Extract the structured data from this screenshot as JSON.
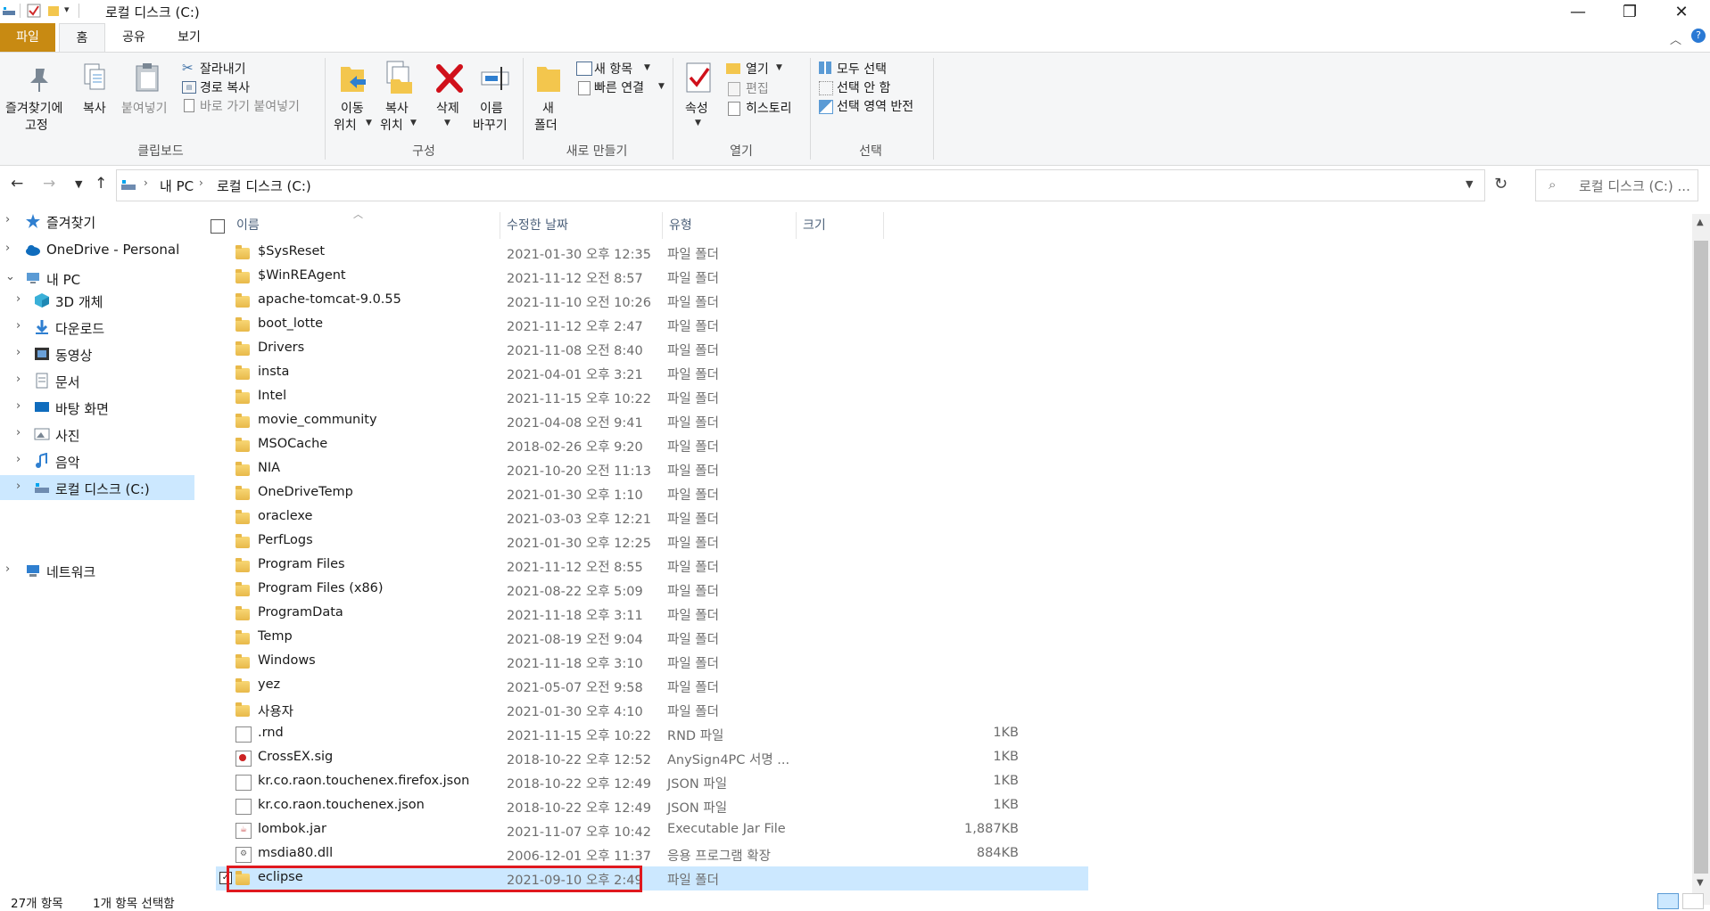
{
  "window": {
    "title": "로컬 디스크 (C:)",
    "qat_dropdown": "▾",
    "controls": {
      "minimize": "—",
      "restore": "❐",
      "close": "✕"
    }
  },
  "tabs": [
    "파일",
    "홈",
    "공유",
    "보기"
  ],
  "ribbon": {
    "clipboard": {
      "pin": "즐겨찾기에",
      "pin2": "고정",
      "copy": "복사",
      "paste": "붙여넣기",
      "cut": "잘라내기",
      "copy_path": "경로 복사",
      "paste_shortcut": "바로 가기 붙여넣기",
      "group": "클립보드"
    },
    "organize": {
      "move1": "이동",
      "move2": "위치",
      "copyto1": "복사",
      "copyto2": "위치",
      "delete": "삭제",
      "rename1": "이름",
      "rename2": "바꾸기",
      "group": "구성"
    },
    "new": {
      "folder1": "새",
      "folder2": "폴더",
      "new_item": "새 항목",
      "easy_access": "빠른 연결",
      "group": "새로 만들기"
    },
    "open": {
      "properties": "속성",
      "open": "열기",
      "edit": "편집",
      "history": "히스토리",
      "group": "열기"
    },
    "select": {
      "all": "모두 선택",
      "none": "선택 안 함",
      "invert": "선택 영역 반전",
      "group": "선택"
    }
  },
  "address": {
    "crumbs": [
      "내 PC",
      "로컬 디스크 (C:)"
    ],
    "search_placeholder": "로컬 디스크 (C:) ..."
  },
  "nav": {
    "favorites": "즐겨찾기",
    "onedrive": "OneDrive - Personal",
    "thispc": "내 PC",
    "children": [
      "3D 개체",
      "다운로드",
      "동영상",
      "문서",
      "바탕 화면",
      "사진",
      "음악",
      "로컬 디스크 (C:)"
    ],
    "network": "네트워크"
  },
  "columns": {
    "name": "이름",
    "date": "수정한 날짜",
    "type": "유형",
    "size": "크기"
  },
  "files": [
    {
      "name": "$SysReset",
      "date": "2021-01-30 오후 12:35",
      "type": "파일 폴더",
      "size": "",
      "kind": "folder"
    },
    {
      "name": "$WinREAgent",
      "date": "2021-11-12 오전 8:57",
      "type": "파일 폴더",
      "size": "",
      "kind": "folder"
    },
    {
      "name": "apache-tomcat-9.0.55",
      "date": "2021-11-10 오전 10:26",
      "type": "파일 폴더",
      "size": "",
      "kind": "folder"
    },
    {
      "name": "boot_lotte",
      "date": "2021-11-12 오후 2:47",
      "type": "파일 폴더",
      "size": "",
      "kind": "folder"
    },
    {
      "name": "Drivers",
      "date": "2021-11-08 오전 8:40",
      "type": "파일 폴더",
      "size": "",
      "kind": "folder"
    },
    {
      "name": "insta",
      "date": "2021-04-01 오후 3:21",
      "type": "파일 폴더",
      "size": "",
      "kind": "folder"
    },
    {
      "name": "Intel",
      "date": "2021-11-15 오후 10:22",
      "type": "파일 폴더",
      "size": "",
      "kind": "folder"
    },
    {
      "name": "movie_community",
      "date": "2021-04-08 오전 9:41",
      "type": "파일 폴더",
      "size": "",
      "kind": "folder"
    },
    {
      "name": "MSOCache",
      "date": "2018-02-26 오후 9:20",
      "type": "파일 폴더",
      "size": "",
      "kind": "folder"
    },
    {
      "name": "NIA",
      "date": "2021-10-20 오전 11:13",
      "type": "파일 폴더",
      "size": "",
      "kind": "folder"
    },
    {
      "name": "OneDriveTemp",
      "date": "2021-01-30 오후 1:10",
      "type": "파일 폴더",
      "size": "",
      "kind": "folder"
    },
    {
      "name": "oraclexe",
      "date": "2021-03-03 오후 12:21",
      "type": "파일 폴더",
      "size": "",
      "kind": "folder"
    },
    {
      "name": "PerfLogs",
      "date": "2021-01-30 오후 12:25",
      "type": "파일 폴더",
      "size": "",
      "kind": "folder"
    },
    {
      "name": "Program Files",
      "date": "2021-11-12 오전 8:55",
      "type": "파일 폴더",
      "size": "",
      "kind": "folder"
    },
    {
      "name": "Program Files (x86)",
      "date": "2021-08-22 오후 5:09",
      "type": "파일 폴더",
      "size": "",
      "kind": "folder"
    },
    {
      "name": "ProgramData",
      "date": "2021-11-18 오후 3:11",
      "type": "파일 폴더",
      "size": "",
      "kind": "folder"
    },
    {
      "name": "Temp",
      "date": "2021-08-19 오전 9:04",
      "type": "파일 폴더",
      "size": "",
      "kind": "folder"
    },
    {
      "name": "Windows",
      "date": "2021-11-18 오후 3:10",
      "type": "파일 폴더",
      "size": "",
      "kind": "folder"
    },
    {
      "name": "yez",
      "date": "2021-05-07 오전 9:58",
      "type": "파일 폴더",
      "size": "",
      "kind": "folder"
    },
    {
      "name": "사용자",
      "date": "2021-01-30 오후 4:10",
      "type": "파일 폴더",
      "size": "",
      "kind": "folder"
    },
    {
      "name": ".rnd",
      "date": "2021-11-15 오후 10:22",
      "type": "RND 파일",
      "size": "1KB",
      "kind": "file"
    },
    {
      "name": "CrossEX.sig",
      "date": "2018-10-22 오후 12:52",
      "type": "AnySign4PC 서명 ...",
      "size": "1KB",
      "kind": "sig"
    },
    {
      "name": "kr.co.raon.touchenex.firefox.json",
      "date": "2018-10-22 오후 12:49",
      "type": "JSON 파일",
      "size": "1KB",
      "kind": "file"
    },
    {
      "name": "kr.co.raon.touchenex.json",
      "date": "2018-10-22 오후 12:49",
      "type": "JSON 파일",
      "size": "1KB",
      "kind": "file"
    },
    {
      "name": "lombok.jar",
      "date": "2021-11-07 오후 10:42",
      "type": "Executable Jar File",
      "size": "1,887KB",
      "kind": "jar"
    },
    {
      "name": "msdia80.dll",
      "date": "2006-12-01 오후 11:37",
      "type": "응용 프로그램 확장",
      "size": "884KB",
      "kind": "dll"
    },
    {
      "name": "eclipse",
      "date": "2021-09-10 오후 2:49",
      "type": "파일 폴더",
      "size": "",
      "kind": "folder",
      "selected": true
    }
  ],
  "status": {
    "count": "27개 항목",
    "selected": "1개 항목 선택함"
  },
  "colors": {
    "file_tab": "#c88a12",
    "selection": "#cce8ff",
    "highlight_box": "#e0191f"
  }
}
